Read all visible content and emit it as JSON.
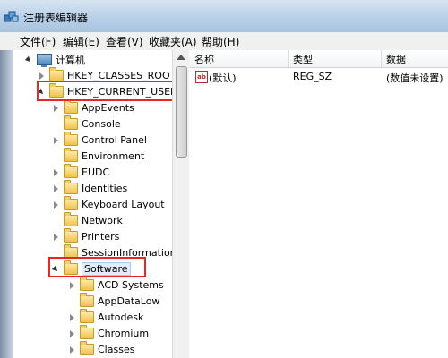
{
  "window": {
    "title": "注册表编辑器"
  },
  "menu": [
    {
      "label": "文件(F)"
    },
    {
      "label": "编辑(E)"
    },
    {
      "label": "查看(V)"
    },
    {
      "label": "收藏夹(A)"
    },
    {
      "label": "帮助(H)"
    }
  ],
  "tree": {
    "root": "计算机",
    "hives": [
      {
        "label": "HKEY_CLASSES_ROOT",
        "state": "collapsed"
      },
      {
        "label": "HKEY_CURRENT_USER",
        "state": "expanded",
        "highlighted": true
      }
    ],
    "hkcu_children": [
      {
        "label": "AppEvents"
      },
      {
        "label": "Console"
      },
      {
        "label": "Control Panel"
      },
      {
        "label": "Environment"
      },
      {
        "label": "EUDC"
      },
      {
        "label": "Identities"
      },
      {
        "label": "Keyboard Layout"
      },
      {
        "label": "Network"
      },
      {
        "label": "Printers"
      },
      {
        "label": "SessionInformation"
      },
      {
        "label": "Software",
        "state": "expanded",
        "selected": true,
        "highlighted": true
      }
    ],
    "software_children": [
      {
        "label": "ACD Systems"
      },
      {
        "label": "AppDataLow"
      },
      {
        "label": "Autodesk"
      },
      {
        "label": "Chromium"
      },
      {
        "label": "Classes"
      }
    ]
  },
  "list": {
    "columns": [
      "名称",
      "类型",
      "数据"
    ],
    "rows": [
      {
        "name": "(默认)",
        "type": "REG_SZ",
        "data": "(数值未设置)",
        "icon": "ab"
      }
    ]
  },
  "colors": {
    "highlight_box": "#e5262c",
    "title_bar": "#b9d0e8"
  }
}
